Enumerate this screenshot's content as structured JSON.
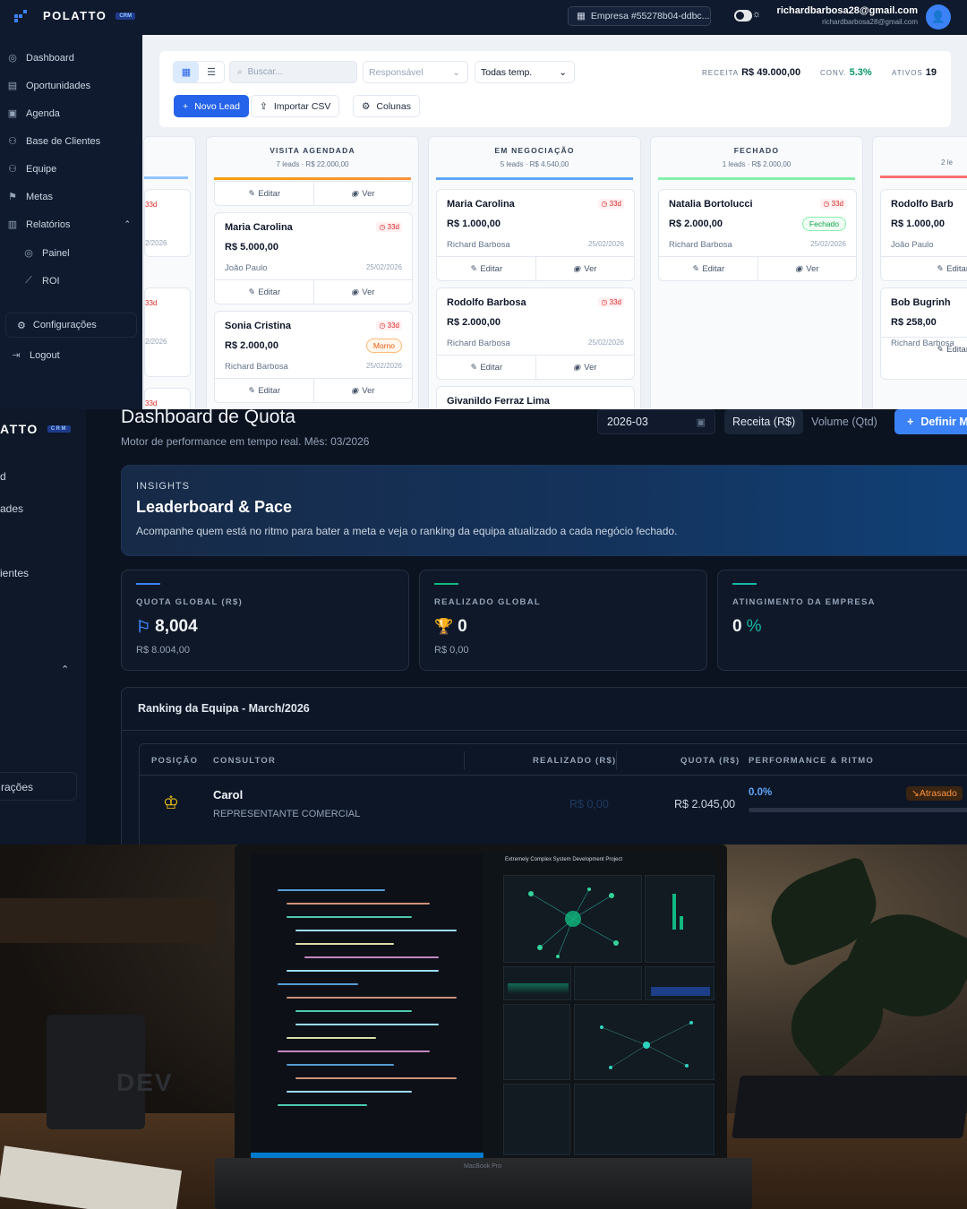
{
  "crm": {
    "brand": "POLATTO",
    "brand_badge": "CRM",
    "company": "Empresa #55278b04-ddbc...",
    "user_email": "richardbarbosa28@gmail.com",
    "user_sub": "richardbarbosa28@gmail.com",
    "sidebar": [
      "Dashboard",
      "Oportunidades",
      "Agenda",
      "Base de Clientes",
      "Equipe",
      "Metas",
      "Relatórios",
      "Painel",
      "ROI"
    ],
    "config": "Configurações",
    "logout": "Logout",
    "search_placeholder": "Buscar...",
    "filter_responsible": "Responsável",
    "filter_temp": "Todas temp.",
    "receita_label": "RECEITA",
    "receita_value": "R$ 49.000,00",
    "conv_label": "CONV.",
    "conv_value": "5.3%",
    "ativos_label": "ATIVOS",
    "ativos_value": "19",
    "btn_new": "Novo Lead",
    "btn_import": "Importar CSV",
    "btn_cols": "Colunas",
    "edit": "Editar",
    "view": "Ver",
    "days": "33d",
    "days2": "33d",
    "days3": "33d",
    "columns": [
      {
        "title": "VISITA AGENDADA",
        "leads": "7 leads",
        "total": "R$ 22.000,00"
      },
      {
        "title": "EM NEGOCIAÇÃO",
        "leads": "5 leads",
        "total": "R$ 4.540,00"
      },
      {
        "title": "FECHADO",
        "leads": "1 leads",
        "total": "R$ 2.000,00"
      },
      {
        "title": "",
        "leads": "2 le",
        "total": ""
      }
    ],
    "cards": [
      {
        "name": "Maria Carolina",
        "value": "R$ 5.000,00",
        "owner": "João Paulo",
        "date": "25/02/2026",
        "days": "33d"
      },
      {
        "name": "Sonia Cristina",
        "value": "R$ 2.000,00",
        "owner": "Richard Barbosa",
        "date": "25/02/2026",
        "days": "33d",
        "tag": "Morno"
      },
      {
        "name": "Maria Carolina",
        "value": "R$ 1.000,00",
        "owner": "Richard Barbosa",
        "date": "25/02/2026",
        "days": "33d"
      },
      {
        "name": "Rodolfo Barbosa",
        "value": "R$ 2.000,00",
        "owner": "Richard Barbosa",
        "date": "25/02/2026",
        "days": "33d"
      },
      {
        "name": "Givanildo Ferraz Lima"
      },
      {
        "name": "Natalia Bortolucci",
        "value": "R$ 2.000,00",
        "owner": "Richard Barbosa",
        "date": "25/02/2026",
        "days": "33d",
        "tag": "Fechado"
      },
      {
        "name": "Rodolfo Barb",
        "value": "R$ 1.000,00",
        "owner": "João Paulo"
      },
      {
        "name": "Bob Bugrinh",
        "value": "R$ 258,00",
        "owner": "Richard Barbosa"
      }
    ],
    "left_partial": [
      "33d",
      "2/2026",
      "33d",
      "2/2026",
      "33d"
    ]
  },
  "quota": {
    "brand": "ATTO",
    "brand_badge": "CRM",
    "side_partial": [
      "ades",
      "ientes",
      "rações"
    ],
    "title": "Dashboard de Quota",
    "subtitle": "Motor de performance em tempo real. Mês: 03/2026",
    "month": "2026-03",
    "seg_revenue": "Receita (R$)",
    "seg_volume": "Volume (Qtd)",
    "btn_define": "Definir M",
    "banner_kicker": "INSIGHTS",
    "banner_title": "Leaderboard & Pace",
    "banner_desc": "Acompanhe quem está no ritmo para bater a meta e veja o ranking da equipa atualizado a cada negócio fechado.",
    "kpi1_label": "QUOTA GLOBAL (R$)",
    "kpi1_value": "8,004",
    "kpi1_sub": "R$ 8.004,00",
    "kpi2_label": "REALIZADO GLOBAL",
    "kpi2_value": "0",
    "kpi2_sub": "R$ 0,00",
    "kpi3_label": "ATINGIMENTO DA EMPRESA",
    "kpi3_value": "0",
    "kpi3_unit": "%",
    "ranking_title": "Ranking da Equipa - March/2026",
    "headers": [
      "POSIÇÃO",
      "CONSULTOR",
      "REALIZADO (R$)",
      "QUOTA (R$)",
      "PERFORMANCE & RITMO"
    ],
    "row": {
      "name": "Carol",
      "role": "REPRESENTANTE COMERCIAL",
      "realizado": "R$ 0,00",
      "quota": "R$ 2.045,00",
      "perf": "0.0%",
      "status": "Atrasado"
    }
  },
  "photo": {
    "mug_text": "DEV",
    "laptop_label": "MacBook Pro",
    "screen_title": "Extremely Complex System Development Project"
  }
}
